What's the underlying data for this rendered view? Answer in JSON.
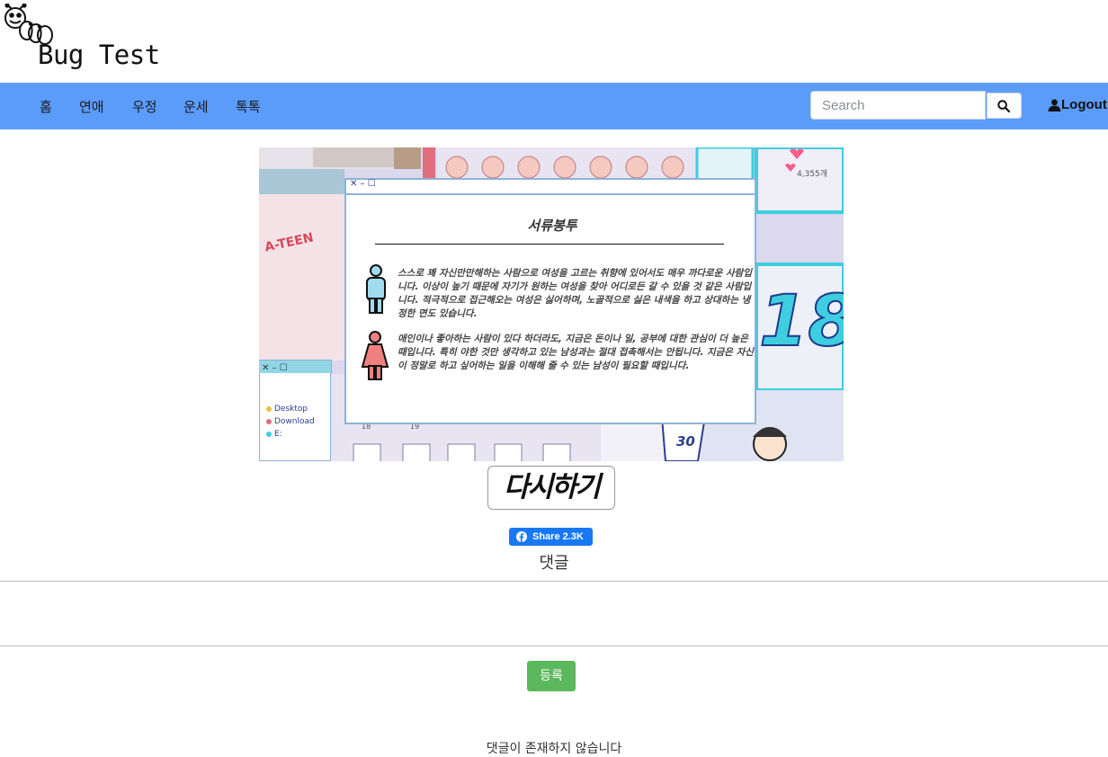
{
  "header": {
    "logo_text": "Bug Test"
  },
  "nav": {
    "items": [
      {
        "label": "홈"
      },
      {
        "label": "연애"
      },
      {
        "label": "우정"
      },
      {
        "label": "운세"
      },
      {
        "label": "톡톡"
      }
    ],
    "search_placeholder": "Search",
    "logout_label": "Logout"
  },
  "result": {
    "window_controls": "✕ – ☐",
    "like_count": "4,355개",
    "side_number": "18",
    "ateen_text": "A-TEEN",
    "title": "서류봉투",
    "male_text": "스스로 꽤 자신만만해하는 사람으로 여성을 고르는 취향에 있어서도 매우 까다로운 사람입니다. 이상이 높기 때문에 자기가 원하는 여성을 찾아 어디로든 갈 수 있을 것 같은 사람입니다. 적극적으로 접근해오는 여성은 싫어하며, 노골적으로 싫은 내색을 하고 상대하는 냉정한 면도 있습니다.",
    "female_text": "애인이나 좋아하는 사람이 있다 하더라도, 지금은 돈이나 일, 공부에 대한 관심이 더 높은 때입니다. 특히 야한 것만 생각하고 있는 남성과는 절대 접촉해서는 안됩니다. 지금은 자신이 정말로 하고 싶어하는 일을 이해해 줄 수 있는 남성이 필요할 때입니다.",
    "folder_items": [
      "Desktop",
      "Download",
      "E:"
    ],
    "folder_numbers": [
      "18",
      "19"
    ],
    "jersey_number": "30"
  },
  "actions": {
    "retry_label": "다시하기",
    "fb_share_label": "Share 2.3K"
  },
  "comments": {
    "title": "댓글",
    "submit_label": "등록",
    "empty_message": "댓글이 존재하지 않습니다"
  },
  "colors": {
    "navbar": "#5b9cfb",
    "facebook": "#1877f2",
    "submit": "#5cb85c"
  }
}
